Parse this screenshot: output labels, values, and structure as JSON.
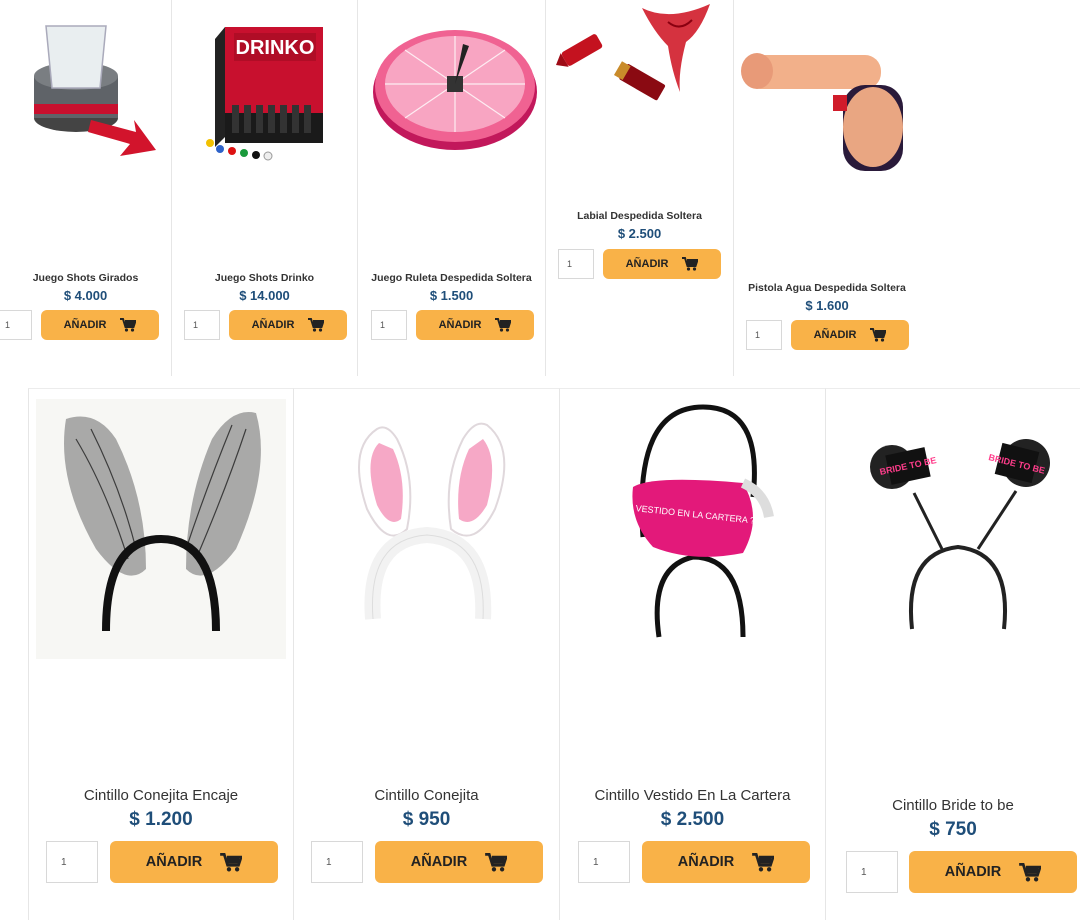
{
  "row_top": [
    {
      "name": "Juego Shots Girados",
      "price": "$ 4.000",
      "qty": "1",
      "button": "AÑADIR",
      "image_icon": "spin-shot-glass-game-image"
    },
    {
      "name": "Juego Shots Drinko",
      "price": "$ 14.000",
      "qty": "1",
      "button": "AÑADIR",
      "image_icon": "drinko-game-image",
      "image_text": "DRINKO"
    },
    {
      "name": "Juego Ruleta Despedida Soltera",
      "price": "$ 1.500",
      "qty": "1",
      "button": "AÑADIR",
      "image_icon": "pink-roulette-image"
    },
    {
      "name": "Labial Despedida Soltera",
      "price": "$ 2.500",
      "qty": "1",
      "button": "AÑADIR",
      "image_icon": "lipstick-lingerie-image"
    },
    {
      "name": "Pistola Agua Despedida Soltera",
      "price": "$ 1.600",
      "qty": "1",
      "button": "AÑADIR",
      "image_icon": "water-pistol-image"
    }
  ],
  "row_bottom": [
    {
      "name": "Cintillo Conejita Encaje",
      "price": "$ 1.200",
      "qty": "1",
      "button": "AÑADIR",
      "image_icon": "lace-bunny-ears-headband-image"
    },
    {
      "name": "Cintillo Conejita",
      "price": "$ 950",
      "qty": "1",
      "button": "AÑADIR",
      "image_icon": "pink-bunny-ears-headband-image"
    },
    {
      "name": "Cintillo Vestido En La Cartera",
      "price": "$ 2.500",
      "qty": "1",
      "button": "AÑADIR",
      "image_icon": "pink-purse-headband-image",
      "image_text": "¿ VESTIDO EN LA CARTERA ?"
    },
    {
      "name": "Cintillo Bride to be",
      "price": "$ 750",
      "qty": "1",
      "button": "AÑADIR",
      "image_icon": "bride-to-be-headband-image",
      "image_text": "BRIDE TO BE"
    }
  ],
  "colors": {
    "button": "#f9b248",
    "price": "#1f4e79",
    "border": "#e6e6e6"
  },
  "cart_icon": "cart-icon"
}
